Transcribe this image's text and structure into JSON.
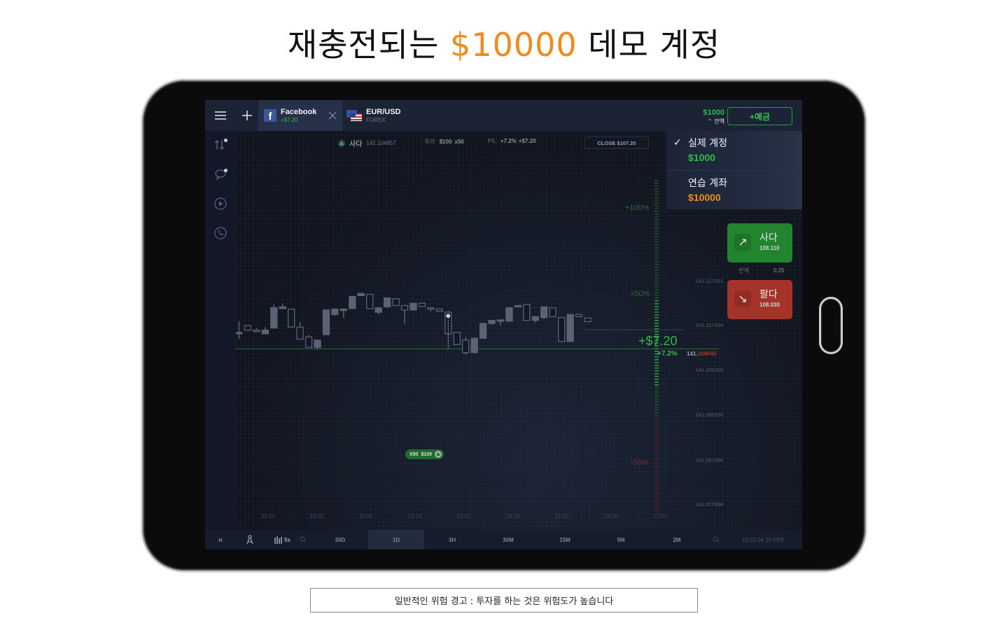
{
  "headline": {
    "prefix": "재충전되는",
    "amount": "$10000",
    "suffix": "데모 계정"
  },
  "app": {
    "tabs": [
      {
        "name": "Facebook",
        "sub": "+$7.20",
        "icon": "facebook-icon"
      },
      {
        "name": "EUR/USD",
        "sub": "FOREX",
        "icon": "eu-us-flag-icon"
      }
    ],
    "balance": {
      "amount": "$1000",
      "label": "잔액"
    },
    "deposit_label": "+예금",
    "dropdown": {
      "items": [
        {
          "name": "실제 계정",
          "amount": "$1000",
          "checked": true,
          "color": "#2fb94a"
        },
        {
          "name": "연습 계좌",
          "amount": "$10000",
          "checked": false,
          "color": "#f08a1c"
        }
      ]
    },
    "deal_info": {
      "direction": "사다",
      "open_price": "141.104857",
      "invest_label": "투자",
      "invest_amount": "$100",
      "multiplier": "x50",
      "pl_label": "P/L",
      "pl_percent": "+7.2%",
      "pl_amount": "+$7.20",
      "close_label": "CLOSE $107.20"
    },
    "pnl_overlay": {
      "amount": "+$7.20",
      "percent": "+7.2%"
    },
    "percent_levels": [
      {
        "label": "+100%",
        "color": "#2a6b35"
      },
      {
        "label": "+50%",
        "color": "#2a6b35"
      },
      {
        "label": "-50%",
        "color": "#7a2e2b"
      }
    ],
    "price_axis": [
      "141.127001",
      "141.117334",
      "141.105209",
      "141.095330",
      "141.087294",
      "141.077858"
    ],
    "current_price": {
      "prefix": "141.",
      "suffix": "109045"
    },
    "entry_marker": {
      "multiplier": "X50",
      "amount": "$100"
    },
    "time_axis": [
      "09:00",
      "10:00",
      "11:00",
      "12:00",
      "13:00",
      "14:00",
      "15:00",
      "16:00",
      "17:00"
    ],
    "trade": {
      "buy": {
        "label": "사다",
        "price": "108.110"
      },
      "sell": {
        "label": "팔다",
        "price": "108.030"
      },
      "spread_label": "전개",
      "spread_value": "0.25"
    },
    "bottom": {
      "candle_interval": "5s",
      "periods": [
        "30D",
        "1D",
        "3H",
        "30M",
        "15M",
        "5M",
        "2M"
      ],
      "active_period": "1D",
      "timestamp": "15:03:24 18 FEB"
    },
    "rail_icons": [
      "deals-icon",
      "chat-icon",
      "video-icon",
      "phone-icon"
    ]
  },
  "chart_data": {
    "type": "candlestick",
    "title": "",
    "x": [
      "09:00",
      "",
      "",
      "",
      "",
      "",
      "",
      "10:00",
      "",
      "",
      "",
      "",
      "",
      "",
      "11:00",
      "",
      "",
      "",
      "",
      "",
      "12:00",
      "",
      "",
      "",
      "",
      "",
      "13:00",
      "",
      "",
      "",
      "",
      "",
      "14:00",
      "",
      "",
      "",
      "",
      "",
      "15:00",
      "",
      "",
      "",
      ""
    ],
    "candles": [
      {
        "o": 141.1085,
        "c": 141.1085,
        "h": 141.111,
        "l": 141.107,
        "filled": true
      },
      {
        "o": 141.109,
        "c": 141.11,
        "h": 141.11,
        "l": 141.109,
        "filled": false
      },
      {
        "o": 141.109,
        "c": 141.1087,
        "h": 141.1095,
        "l": 141.1087,
        "filled": false
      },
      {
        "o": 141.109,
        "c": 141.1082,
        "h": 141.1097,
        "l": 141.1082,
        "filled": true
      },
      {
        "o": 141.1095,
        "c": 141.114,
        "h": 141.1147,
        "l": 141.1095,
        "filled": true
      },
      {
        "o": 141.1142,
        "c": 141.1138,
        "h": 141.115,
        "l": 141.1138,
        "filled": true
      },
      {
        "o": 141.1137,
        "c": 141.1097,
        "h": 141.1137,
        "l": 141.1097,
        "filled": false
      },
      {
        "o": 141.1097,
        "c": 141.107,
        "h": 141.1108,
        "l": 141.107,
        "filled": false
      },
      {
        "o": 141.1075,
        "c": 141.1052,
        "h": 141.108,
        "l": 141.1052,
        "filled": false
      },
      {
        "o": 141.1068,
        "c": 141.1052,
        "h": 141.1068,
        "l": 141.1047,
        "filled": true
      },
      {
        "o": 141.108,
        "c": 141.1135,
        "h": 141.1135,
        "l": 141.108,
        "filled": true
      },
      {
        "o": 141.1137,
        "c": 141.1125,
        "h": 141.1137,
        "l": 141.1122,
        "filled": true
      },
      {
        "o": 141.1137,
        "c": 141.1135,
        "h": 141.1137,
        "l": 141.1117,
        "filled": true
      },
      {
        "o": 141.1138,
        "c": 141.1165,
        "h": 141.1165,
        "l": 141.1138,
        "filled": true
      },
      {
        "o": 141.1167,
        "c": 141.1172,
        "h": 141.1172,
        "l": 141.1167,
        "filled": true
      },
      {
        "o": 141.117,
        "c": 141.1138,
        "h": 141.117,
        "l": 141.1138,
        "filled": false
      },
      {
        "o": 141.114,
        "c": 141.113,
        "h": 141.114,
        "l": 141.1125,
        "filled": true
      },
      {
        "o": 141.1162,
        "c": 141.1142,
        "h": 141.1162,
        "l": 141.114,
        "filled": true
      },
      {
        "o": 141.116,
        "c": 141.1145,
        "h": 141.116,
        "l": 141.1145,
        "filled": false
      },
      {
        "o": 141.1145,
        "c": 141.1135,
        "h": 141.1145,
        "l": 141.1105,
        "filled": false
      },
      {
        "o": 141.115,
        "c": 141.1135,
        "h": 141.115,
        "l": 141.1135,
        "filled": true
      },
      {
        "o": 141.115,
        "c": 141.1143,
        "h": 141.115,
        "l": 141.1143,
        "filled": false
      },
      {
        "o": 141.114,
        "c": 141.1137,
        "h": 141.114,
        "l": 141.1132,
        "filled": false
      },
      {
        "o": 141.1137,
        "c": 141.1132,
        "h": 141.1137,
        "l": 141.1132,
        "filled": false
      },
      {
        "o": 141.113,
        "c": 141.1082,
        "h": 141.1133,
        "l": 141.1082,
        "filled": false
      },
      {
        "o": 141.1085,
        "c": 141.1058,
        "h": 141.1085,
        "l": 141.1058,
        "filled": false
      },
      {
        "o": 141.1068,
        "c": 141.104,
        "h": 141.1075,
        "l": 141.1035,
        "filled": false
      },
      {
        "o": 141.1072,
        "c": 141.104,
        "h": 141.1072,
        "l": 141.104,
        "filled": true
      },
      {
        "o": 141.1105,
        "c": 141.1072,
        "h": 141.1105,
        "l": 141.1072,
        "filled": true
      },
      {
        "o": 141.1112,
        "c": 141.1105,
        "h": 141.1112,
        "l": 141.1102,
        "filled": true
      },
      {
        "o": 141.1113,
        "c": 141.111,
        "h": 141.1113,
        "l": 141.11,
        "filled": true
      },
      {
        "o": 141.114,
        "c": 141.111,
        "h": 141.114,
        "l": 141.111,
        "filled": true
      },
      {
        "o": 141.1145,
        "c": 141.1142,
        "h": 141.1145,
        "l": 141.1142,
        "filled": true
      },
      {
        "o": 141.1147,
        "c": 141.1112,
        "h": 141.1147,
        "l": 141.1112,
        "filled": false
      },
      {
        "o": 141.112,
        "c": 141.1112,
        "h": 141.112,
        "l": 141.1107,
        "filled": true
      },
      {
        "o": 141.1142,
        "c": 141.1118,
        "h": 141.1142,
        "l": 141.1115,
        "filled": true
      },
      {
        "o": 141.114,
        "c": 141.112,
        "h": 141.114,
        "l": 141.112,
        "filled": false
      },
      {
        "o": 141.1118,
        "c": 141.1065,
        "h": 141.1118,
        "l": 141.1065,
        "filled": false
      },
      {
        "o": 141.1125,
        "c": 141.1065,
        "h": 141.1125,
        "l": 141.1065,
        "filled": true
      },
      {
        "o": 141.1125,
        "c": 141.112,
        "h": 141.1125,
        "l": 141.112,
        "filled": false
      },
      {
        "o": 141.1117,
        "c": 141.1109,
        "h": 141.1117,
        "l": 141.1109,
        "filled": false
      }
    ],
    "entry_price": 141.104857,
    "current_price": 141.109045,
    "ylim": [
      141.077,
      141.13
    ]
  }
}
